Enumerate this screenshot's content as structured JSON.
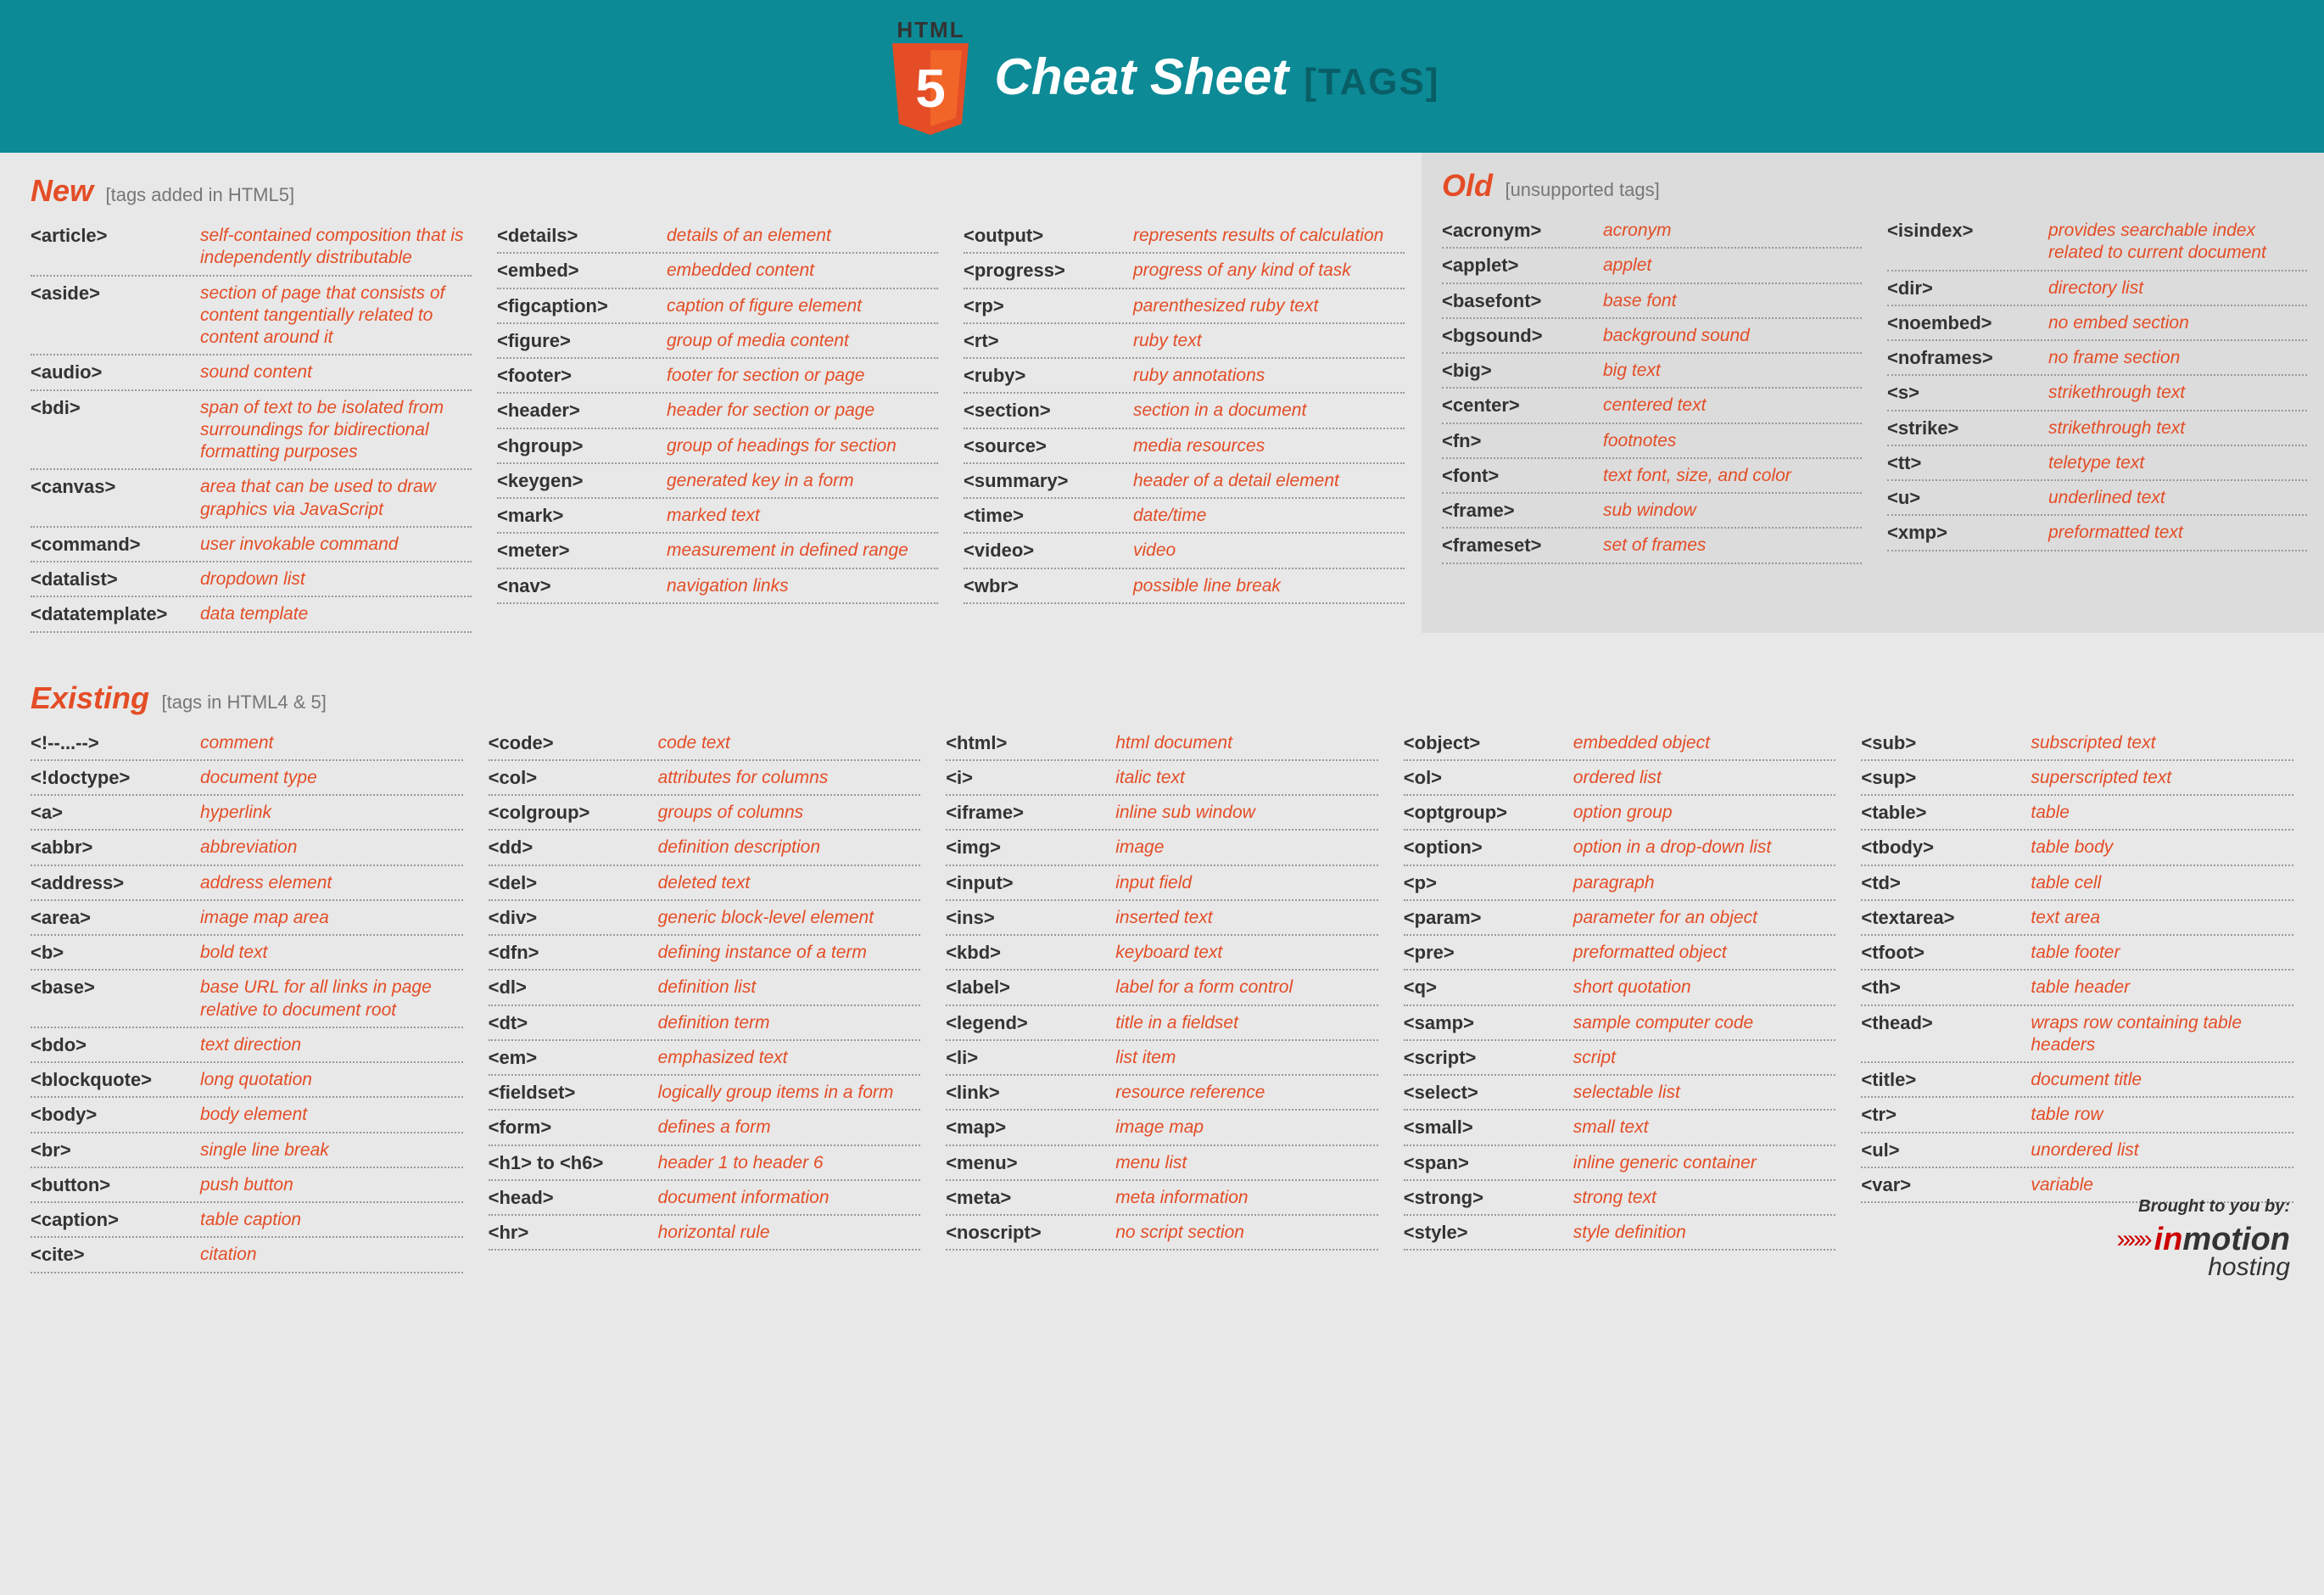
{
  "header": {
    "logo_top": "HTML",
    "logo_number": "5",
    "title": "Cheat Sheet",
    "suffix": "[TAGS]"
  },
  "sections": {
    "new": {
      "title": "New",
      "subtitle": "[tags added in HTML5]",
      "cols": [
        [
          {
            "tag": "<article>",
            "desc": "self-contained composition that is independently distributable"
          },
          {
            "tag": "<aside>",
            "desc": "section of page that consists of content tangentially related to content around it"
          },
          {
            "tag": "<audio>",
            "desc": "sound content"
          },
          {
            "tag": "<bdi>",
            "desc": "span of text to be isolated from surroundings for bidirectional formatting purposes"
          },
          {
            "tag": "<canvas>",
            "desc": "area that can be used to draw graphics via JavaScript"
          },
          {
            "tag": "<command>",
            "desc": "user invokable command"
          },
          {
            "tag": "<datalist>",
            "desc": "dropdown list"
          },
          {
            "tag": "<datatemplate>",
            "desc": "data template"
          }
        ],
        [
          {
            "tag": "<details>",
            "desc": "details of an element"
          },
          {
            "tag": "<embed>",
            "desc": "embedded content"
          },
          {
            "tag": "<figcaption>",
            "desc": "caption of figure element"
          },
          {
            "tag": "<figure>",
            "desc": "group of media content"
          },
          {
            "tag": "<footer>",
            "desc": "footer for section or page"
          },
          {
            "tag": "<header>",
            "desc": "header for section or page"
          },
          {
            "tag": "<hgroup>",
            "desc": "group of headings for section"
          },
          {
            "tag": "<keygen>",
            "desc": "generated key in a form"
          },
          {
            "tag": "<mark>",
            "desc": "marked text"
          },
          {
            "tag": "<meter>",
            "desc": "measurement in defined range"
          },
          {
            "tag": "<nav>",
            "desc": "navigation links"
          }
        ],
        [
          {
            "tag": "<output>",
            "desc": "represents results of calculation"
          },
          {
            "tag": "<progress>",
            "desc": "progress of any kind of task"
          },
          {
            "tag": "<rp>",
            "desc": "parenthesized ruby text"
          },
          {
            "tag": "<rt>",
            "desc": "ruby text"
          },
          {
            "tag": "<ruby>",
            "desc": "ruby annotations"
          },
          {
            "tag": "<section>",
            "desc": "section in a document"
          },
          {
            "tag": "<source>",
            "desc": "media resources"
          },
          {
            "tag": "<summary>",
            "desc": "header of a detail element"
          },
          {
            "tag": "<time>",
            "desc": "date/time"
          },
          {
            "tag": "<video>",
            "desc": "video"
          },
          {
            "tag": "<wbr>",
            "desc": "possible line break"
          }
        ]
      ]
    },
    "old": {
      "title": "Old",
      "subtitle": "[unsupported tags]",
      "cols": [
        [
          {
            "tag": "<acronym>",
            "desc": "acronym"
          },
          {
            "tag": "<applet>",
            "desc": "applet"
          },
          {
            "tag": "<basefont>",
            "desc": "base font"
          },
          {
            "tag": "<bgsound>",
            "desc": "background sound"
          },
          {
            "tag": "<big>",
            "desc": "big text"
          },
          {
            "tag": "<center>",
            "desc": "centered text"
          },
          {
            "tag": "<fn>",
            "desc": "footnotes"
          },
          {
            "tag": "<font>",
            "desc": "text font, size, and color"
          },
          {
            "tag": "<frame>",
            "desc": "sub window"
          },
          {
            "tag": "<frameset>",
            "desc": "set of frames"
          }
        ],
        [
          {
            "tag": "<isindex>",
            "desc": "provides searchable index related to current document"
          },
          {
            "tag": "<dir>",
            "desc": "directory list"
          },
          {
            "tag": "<noembed>",
            "desc": "no embed section"
          },
          {
            "tag": "<noframes>",
            "desc": "no frame section"
          },
          {
            "tag": "<s>",
            "desc": "strikethrough text"
          },
          {
            "tag": "<strike>",
            "desc": "strikethrough text"
          },
          {
            "tag": "<tt>",
            "desc": "teletype text"
          },
          {
            "tag": "<u>",
            "desc": "underlined text"
          },
          {
            "tag": "<xmp>",
            "desc": "preformatted text"
          }
        ]
      ]
    },
    "existing": {
      "title": "Existing",
      "subtitle": "[tags in HTML4 & 5]",
      "cols": [
        [
          {
            "tag": "<!--...-->",
            "desc": "comment"
          },
          {
            "tag": "<!doctype>",
            "desc": "document type"
          },
          {
            "tag": "<a>",
            "desc": "hyperlink"
          },
          {
            "tag": "<abbr>",
            "desc": "abbreviation"
          },
          {
            "tag": "<address>",
            "desc": "address element"
          },
          {
            "tag": "<area>",
            "desc": "image map area"
          },
          {
            "tag": "<b>",
            "desc": "bold text"
          },
          {
            "tag": "<base>",
            "desc": "base URL for all links in page relative to document root"
          },
          {
            "tag": "<bdo>",
            "desc": "text direction"
          },
          {
            "tag": "<blockquote>",
            "desc": "long quotation"
          },
          {
            "tag": "<body>",
            "desc": "body element"
          },
          {
            "tag": "<br>",
            "desc": "single line break"
          },
          {
            "tag": "<button>",
            "desc": "push button"
          },
          {
            "tag": "<caption>",
            "desc": "table caption"
          },
          {
            "tag": "<cite>",
            "desc": "citation"
          }
        ],
        [
          {
            "tag": "<code>",
            "desc": "code text"
          },
          {
            "tag": "<col>",
            "desc": "attributes for columns"
          },
          {
            "tag": "<colgroup>",
            "desc": "groups of columns"
          },
          {
            "tag": "<dd>",
            "desc": "definition description"
          },
          {
            "tag": "<del>",
            "desc": "deleted text"
          },
          {
            "tag": "<div>",
            "desc": "generic block-level element"
          },
          {
            "tag": "<dfn>",
            "desc": "defining instance of a term"
          },
          {
            "tag": "<dl>",
            "desc": "definition list"
          },
          {
            "tag": "<dt>",
            "desc": "definition term"
          },
          {
            "tag": "<em>",
            "desc": "emphasized text"
          },
          {
            "tag": "<fieldset>",
            "desc": "logically group items in a form"
          },
          {
            "tag": "<form>",
            "desc": "defines a form"
          },
          {
            "tag": "<h1> to <h6>",
            "desc": "header 1 to header 6"
          },
          {
            "tag": "<head>",
            "desc": "document information"
          },
          {
            "tag": "<hr>",
            "desc": "horizontal rule"
          }
        ],
        [
          {
            "tag": "<html>",
            "desc": "html document"
          },
          {
            "tag": "<i>",
            "desc": "italic text"
          },
          {
            "tag": "<iframe>",
            "desc": "inline sub window"
          },
          {
            "tag": "<img>",
            "desc": "image"
          },
          {
            "tag": "<input>",
            "desc": "input field"
          },
          {
            "tag": "<ins>",
            "desc": "inserted text"
          },
          {
            "tag": "<kbd>",
            "desc": "keyboard text"
          },
          {
            "tag": "<label>",
            "desc": "label for a form control"
          },
          {
            "tag": "<legend>",
            "desc": "title in a fieldset"
          },
          {
            "tag": "<li>",
            "desc": "list item"
          },
          {
            "tag": "<link>",
            "desc": "resource reference"
          },
          {
            "tag": "<map>",
            "desc": "image map"
          },
          {
            "tag": "<menu>",
            "desc": "menu list"
          },
          {
            "tag": "<meta>",
            "desc": "meta information"
          },
          {
            "tag": "<noscript>",
            "desc": "no script section"
          }
        ],
        [
          {
            "tag": "<object>",
            "desc": "embedded object"
          },
          {
            "tag": "<ol>",
            "desc": "ordered list"
          },
          {
            "tag": "<optgroup>",
            "desc": "option group"
          },
          {
            "tag": "<option>",
            "desc": "option in a drop-down list"
          },
          {
            "tag": "<p>",
            "desc": "paragraph"
          },
          {
            "tag": "<param>",
            "desc": "parameter for an object"
          },
          {
            "tag": "<pre>",
            "desc": "preformatted object"
          },
          {
            "tag": "<q>",
            "desc": "short quotation"
          },
          {
            "tag": "<samp>",
            "desc": "sample computer code"
          },
          {
            "tag": "<script>",
            "desc": "script"
          },
          {
            "tag": "<select>",
            "desc": "selectable list"
          },
          {
            "tag": "<small>",
            "desc": "small text"
          },
          {
            "tag": "<span>",
            "desc": "inline generic container"
          },
          {
            "tag": "<strong>",
            "desc": "strong text"
          },
          {
            "tag": "<style>",
            "desc": "style definition"
          }
        ],
        [
          {
            "tag": "<sub>",
            "desc": "subscripted text"
          },
          {
            "tag": "<sup>",
            "desc": "superscripted text"
          },
          {
            "tag": "<table>",
            "desc": "table"
          },
          {
            "tag": "<tbody>",
            "desc": "table body"
          },
          {
            "tag": "<td>",
            "desc": "table cell"
          },
          {
            "tag": "<textarea>",
            "desc": "text area"
          },
          {
            "tag": "<tfoot>",
            "desc": "table footer"
          },
          {
            "tag": "<th>",
            "desc": "table header"
          },
          {
            "tag": "<thead>",
            "desc": "wraps row containing table headers"
          },
          {
            "tag": "<title>",
            "desc": "document title"
          },
          {
            "tag": "<tr>",
            "desc": "table row"
          },
          {
            "tag": "<ul>",
            "desc": "unordered list"
          },
          {
            "tag": "<var>",
            "desc": "variable"
          }
        ]
      ]
    }
  },
  "footer": {
    "brought": "Brought to you by:",
    "brand_in": "in",
    "brand_motion": "motion",
    "brand_hosting": "hosting"
  }
}
